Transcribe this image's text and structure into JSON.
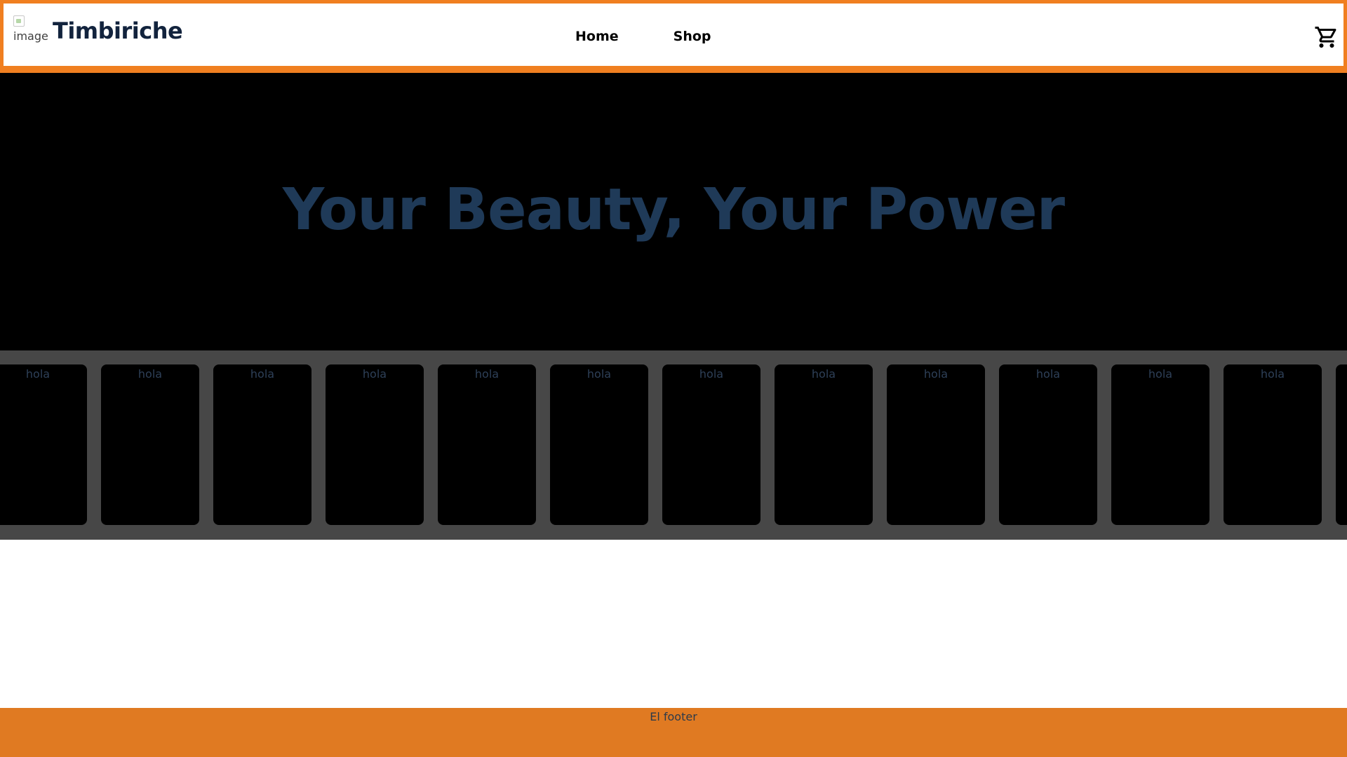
{
  "header": {
    "logo_alt": "image",
    "brand": "Timbiriche",
    "nav": [
      {
        "label": "Home"
      },
      {
        "label": "Shop"
      }
    ],
    "cart_icon": "shopping-cart-icon"
  },
  "hero": {
    "title": "Your Beauty, Your Power"
  },
  "carousel": {
    "cards": [
      {
        "label": "hola"
      },
      {
        "label": "hola"
      },
      {
        "label": "hola"
      },
      {
        "label": "hola"
      },
      {
        "label": "hola"
      },
      {
        "label": "hola"
      },
      {
        "label": "hola"
      },
      {
        "label": "hola"
      },
      {
        "label": "hola"
      },
      {
        "label": "hola"
      },
      {
        "label": "hola"
      },
      {
        "label": "hola"
      },
      {
        "label": ""
      }
    ]
  },
  "footer": {
    "text": "El footer"
  },
  "colors": {
    "accent": "#f07f20",
    "footer": "#e07a22",
    "hero_bg": "#000000",
    "carousel_bg": "#474747",
    "title": "#1f3a58"
  }
}
